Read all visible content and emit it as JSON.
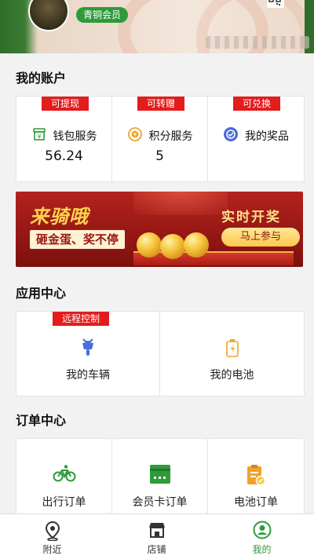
{
  "header": {
    "member_level": "青铜会员"
  },
  "account": {
    "title": "我的账户",
    "items": [
      {
        "tag": "可提现",
        "label": "钱包服务",
        "value": "56.24",
        "icon": "wallet-icon"
      },
      {
        "tag": "可转赠",
        "label": "积分服务",
        "value": "5",
        "icon": "coin-icon"
      },
      {
        "tag": "可兑换",
        "label": "我的奖品",
        "value": "",
        "icon": "prize-icon"
      }
    ]
  },
  "banner": {
    "brand": "来骑哦",
    "slogan": "砸金蛋、奖不停",
    "headline": "实时开奖",
    "button": "马上参与"
  },
  "apps": {
    "title": "应用中心",
    "items": [
      {
        "tag": "远程控制",
        "label": "我的车辆",
        "icon": "scooter-icon"
      },
      {
        "tag": "",
        "label": "我的电池",
        "icon": "battery-icon"
      }
    ]
  },
  "orders": {
    "title": "订单中心",
    "items": [
      {
        "label": "出行订单",
        "icon": "bicycle-icon"
      },
      {
        "label": "会员卡订单",
        "icon": "membership-card-icon"
      },
      {
        "label": "电池订单",
        "icon": "battery-order-icon"
      }
    ]
  },
  "bottom_nav": {
    "items": [
      {
        "label": "附近",
        "icon": "location-pin-icon",
        "active": false
      },
      {
        "label": "店铺",
        "icon": "store-icon",
        "active": false
      },
      {
        "label": "我的",
        "icon": "user-icon",
        "active": true
      }
    ]
  },
  "colors": {
    "accent_green": "#2e9b3a",
    "tag_red": "#e41c1c",
    "icon_orange": "#f0a22a",
    "icon_blue": "#4a6bdb"
  }
}
